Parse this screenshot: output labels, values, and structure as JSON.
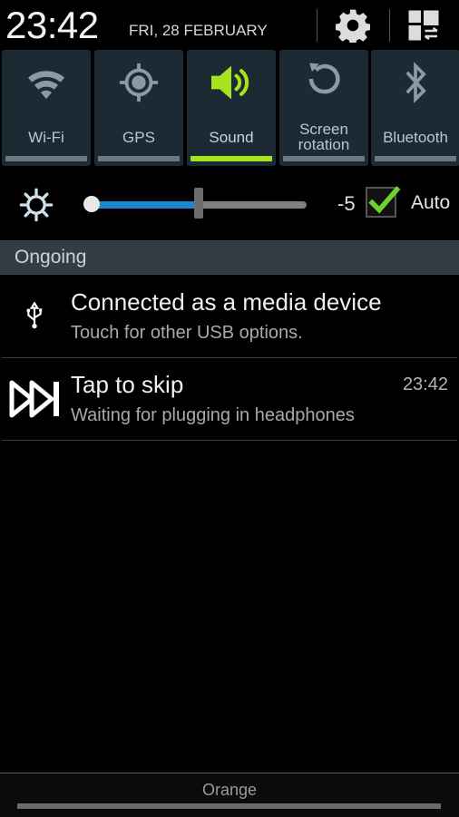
{
  "status_header": {
    "time": "23:42",
    "date": "FRI, 28 FEBRUARY",
    "settings_icon": "gear-icon",
    "edit_icon": "grid-swap-icon"
  },
  "quick_toggles": [
    {
      "label": "Wi-Fi",
      "icon": "wifi-icon",
      "active": false
    },
    {
      "label": "GPS",
      "icon": "gps-icon",
      "active": false
    },
    {
      "label": "Sound",
      "icon": "speaker-icon",
      "active": true
    },
    {
      "label": "Screen rotation",
      "icon": "rotation-icon",
      "active": false
    },
    {
      "label": "Bluetooth",
      "icon": "bluetooth-icon",
      "active": false
    }
  ],
  "brightness": {
    "icon": "sun-icon",
    "value_label": "-5",
    "level_fraction": 0.5,
    "auto_label": "Auto",
    "auto_checked": true
  },
  "section": {
    "title": "Ongoing"
  },
  "notifications": [
    {
      "icon": "usb-icon",
      "title": "Connected as a media device",
      "text": "Touch for other USB options.",
      "time": ""
    },
    {
      "icon": "skip-forward-icon",
      "title": "Tap to skip",
      "text": "Waiting for plugging in headphones",
      "time": "23:42"
    }
  ],
  "footer": {
    "carrier": "Orange"
  },
  "colors": {
    "active": "#a6e21e",
    "slider_fill": "#1d86d0",
    "tile_bg": "#1c2a33",
    "section_bg": "#333d45"
  }
}
